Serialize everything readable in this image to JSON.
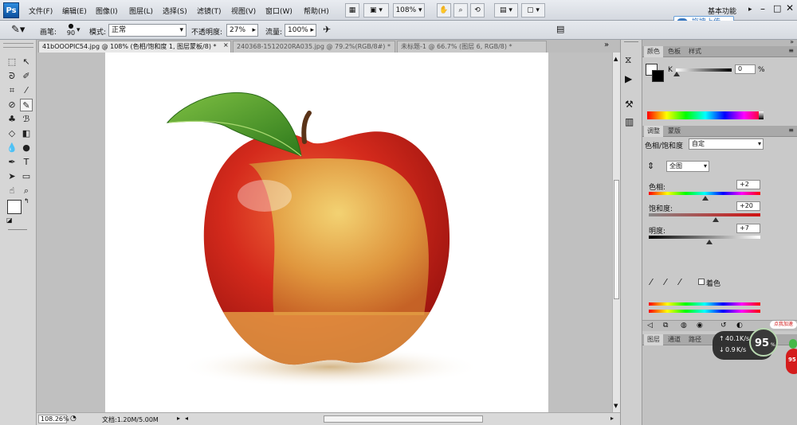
{
  "app": {
    "logo": "Ps"
  },
  "menus": [
    "文件(F)",
    "编辑(E)",
    "图像(I)",
    "图层(L)",
    "选择(S)",
    "滤镜(T)",
    "视图(V)",
    "窗口(W)",
    "帮助(H)"
  ],
  "menubar": {
    "zoom": "108%",
    "workspace": "基本功能",
    "cloud_btn": "拖拽上传"
  },
  "options": {
    "brush_label": "画笔:",
    "brush_size": "90",
    "mode_label": "模式:",
    "mode_value": "正常",
    "opacity_label": "不透明度:",
    "opacity_value": "27%",
    "flow_label": "流量:",
    "flow_value": "100%"
  },
  "tabs": [
    {
      "label": "41bOOOPIC54.jpg @ 108% (色相/饱和度 1, 图层蒙板/8) *"
    },
    {
      "label": "240368-1512020RA035.jpg @ 79.2%(RGB/8#) *"
    },
    {
      "label": "未标题-1 @ 66.7% (图层 6, RGB/8) *"
    }
  ],
  "status": {
    "zoom": "108.26%",
    "doc_info": "文档:1.20M/5.00M"
  },
  "color_panel": {
    "tabs": [
      "颜色",
      "色板",
      "样式"
    ],
    "channel_label": "K",
    "value": "0",
    "unit": "%"
  },
  "adjust_panel": {
    "tabs": [
      "调整",
      "蒙版"
    ],
    "title": "色相/饱和度",
    "preset": "自定",
    "channel": "全图",
    "hue_label": "色相:",
    "hue_value": "+2",
    "hue_level": 0.51,
    "sat_label": "饱和度:",
    "sat_value": "+20",
    "sat_level": 0.6,
    "light_label": "明度:",
    "light_value": "+7",
    "light_level": 0.54,
    "colorize_label": "着色"
  },
  "layers_tabs": [
    "图层",
    "通道",
    "路径"
  ],
  "monitor": {
    "up": "40.1",
    "up_unit": "K/s",
    "down": "0.9",
    "down_unit": "K/s",
    "score": "95",
    "score_unit": "%",
    "badge": "点我加速",
    "score2": "95"
  },
  "colors": {
    "app_bg": "#c8c8c8",
    "ps_blue": "#1c6fc4",
    "apple_red": "#c8201a",
    "leaf_green": "#4e9a2a"
  }
}
